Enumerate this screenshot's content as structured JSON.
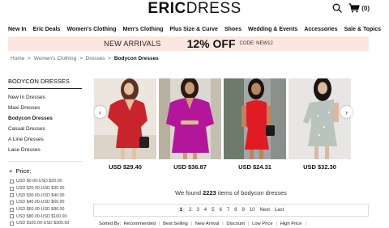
{
  "header": {
    "logo_part1": "ERIC",
    "logo_part2": "DRESS",
    "cart_count": "(0)"
  },
  "nav": [
    "New In",
    "Eric Deals",
    "Women's Clothing",
    "Men's Clothing",
    "Plus Size & Curve",
    "Shoes",
    "Wedding & Events",
    "Accessories",
    "Sale & Topics"
  ],
  "promo": {
    "label": "NEW ARRIVALS",
    "discount": "12% OFF",
    "code": "CODE: NEW12"
  },
  "breadcrumb": {
    "items": [
      "Home",
      "Women's Clothing",
      "Dresses"
    ],
    "current": "Bodycon Dresses",
    "separator": ">"
  },
  "sidebar": {
    "title": "BODYCON DRESSES",
    "links": [
      "New In Dresses",
      "Maxi Dresses",
      "Bodycon Dresses",
      "Casual Dresses",
      "A Line Dresses",
      "Lace Dresses"
    ],
    "active_link": "Bodycon Dresses",
    "price_heading": "Price:",
    "price_toggle": "+",
    "price_ranges": [
      "USD $0.00-USD $20.00",
      "USD $20.00-USD $30.00",
      "USD $30.00-USD $40.00",
      "USD $40.00-USD $60.00",
      "USD $60.00-USD $80.00",
      "USD $80.00-USD $100.00",
      "USD $100.00-USD $300.00"
    ]
  },
  "products": [
    {
      "price": "USD $29.40",
      "colors": {
        "bg": "#ece6df",
        "dress": "#c8242b",
        "skin": "#e7c0a4",
        "hair": "#5a3422"
      }
    },
    {
      "price": "USD $36.87",
      "colors": {
        "bg": "#dcd8cf",
        "dress": "#b3169b",
        "skin": "#c89a78",
        "hair": "#2a1a12"
      }
    },
    {
      "price": "USD $24.31",
      "colors": {
        "bg": "#a4a7a6",
        "dress": "#e01b24",
        "skin": "#b8855e",
        "hair": "#1a120c"
      }
    },
    {
      "price": "USD $32.30",
      "colors": {
        "bg": "#e8e6e4",
        "dress": "#b9c4be",
        "skin": "#d9b8a4",
        "hair": "#1b1410"
      }
    }
  ],
  "results": {
    "prefix": "We found",
    "count": "2223",
    "suffix": "items of bodycon dresses"
  },
  "pagination": {
    "pages": [
      "1",
      "2",
      "3",
      "4",
      "5",
      "6",
      "7",
      "8",
      "9",
      "10"
    ],
    "current": "1",
    "next": "Next",
    "last": "Last"
  },
  "sort": {
    "label": "Sorted By:",
    "options": [
      "Recommended",
      "Best Selling",
      "New Arrival",
      "Discount",
      "Low Price",
      "High Price"
    ]
  },
  "arrows": {
    "prev": "‹",
    "next": "›"
  }
}
